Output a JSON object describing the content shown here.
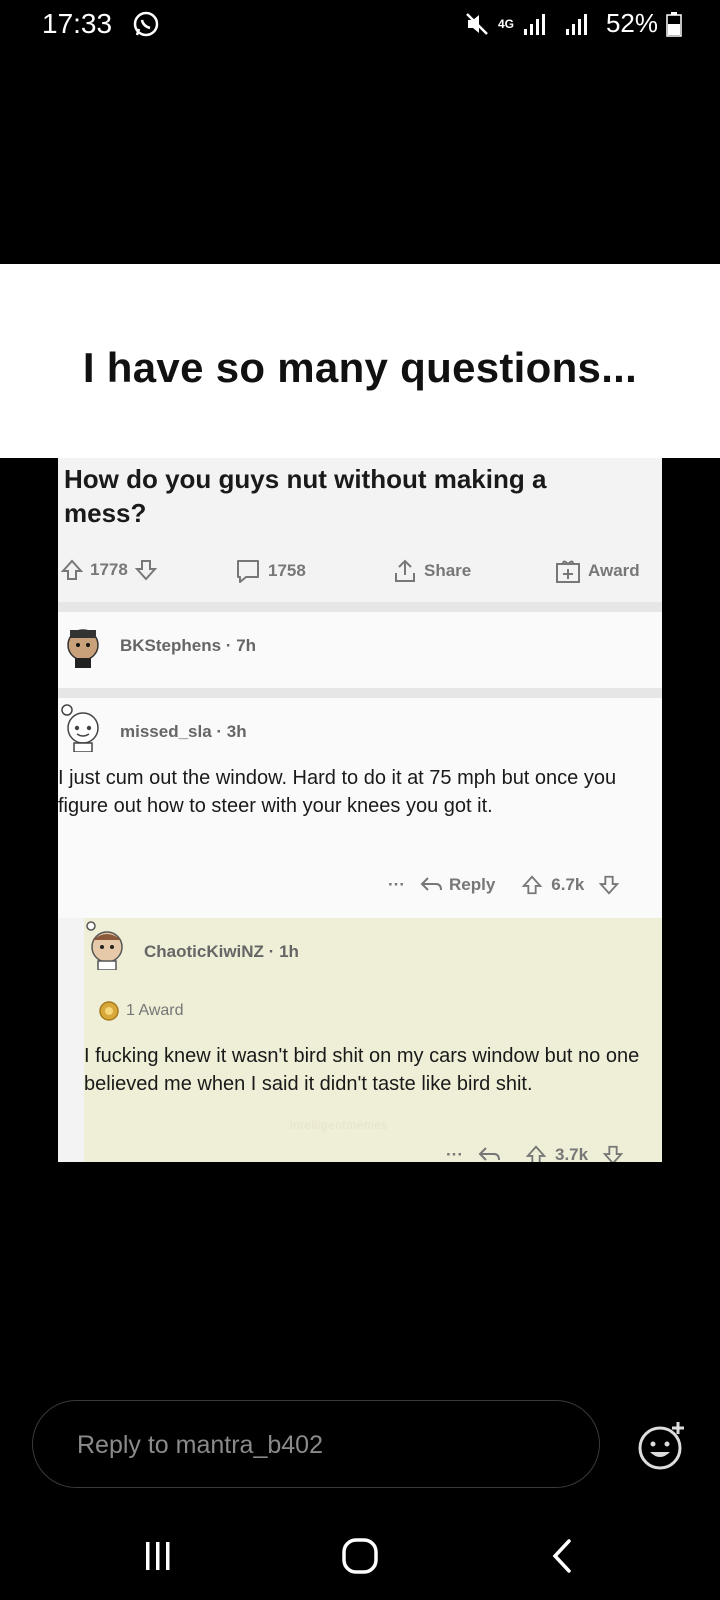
{
  "status_bar": {
    "time": "17:33",
    "battery": "52%",
    "network": "4G"
  },
  "caption": "I have so many questions...",
  "post": {
    "title": "How do you guys nut without making a mess?",
    "upvotes": "1778",
    "comments": "1758",
    "share_label": "Share",
    "award_label": "Award"
  },
  "comments": [
    {
      "username": "BKStephens",
      "time": "7h"
    },
    {
      "username": "missed_sla",
      "time": "3h",
      "text": "I just cum out the window. Hard to do it at 75 mph but once you figure out how to steer with your knees you got it.",
      "reply_label": "Reply",
      "score": "6.7k"
    },
    {
      "username": "ChaoticKiwiNZ",
      "time": "1h",
      "award": "1 Award",
      "text": "I fucking knew it wasn't bird shit on my cars window but no one believed me when I said it didn't taste like bird shit.",
      "score": "3.7k"
    }
  ],
  "watermark": "intelligentmemes",
  "reply_bar": {
    "placeholder": "Reply to mantra_b402"
  },
  "icons": [
    "whatsapp-icon",
    "mute-icon",
    "signal-icon",
    "battery-icon",
    "upvote-icon",
    "downvote-icon",
    "comment-icon",
    "share-icon",
    "award-icon",
    "emoji-add-icon",
    "recents-icon",
    "home-icon",
    "back-icon"
  ]
}
